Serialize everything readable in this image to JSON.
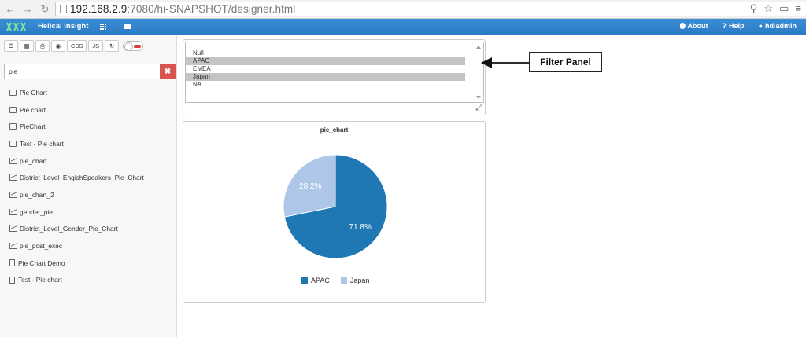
{
  "browser": {
    "url_host": "192.168.2.9",
    "url_path": ":7080/hi-SNAPSHOT/designer.html"
  },
  "app_nav": {
    "brand": "Helical Insight",
    "about": "About",
    "help": "Help",
    "user": "hdiadmin"
  },
  "toolbar": {
    "css_label": "CSS",
    "js_label": "JS"
  },
  "search": {
    "value": "pie",
    "clear_icon": "✖"
  },
  "file_list": [
    {
      "label": "Pie Chart",
      "icon": "folder-icon"
    },
    {
      "label": "Pie chart",
      "icon": "folder-icon"
    },
    {
      "label": "PieChart",
      "icon": "folder-icon"
    },
    {
      "label": "Test - Pie chart",
      "icon": "folder-icon"
    },
    {
      "label": "pie_chart",
      "icon": "line-chart-icon"
    },
    {
      "label": "District_Level_EngishSpeakers_Pie_Chart",
      "icon": "line-chart-icon"
    },
    {
      "label": "pie_chart_2",
      "icon": "line-chart-icon"
    },
    {
      "label": "gender_pie",
      "icon": "line-chart-icon"
    },
    {
      "label": "District_Level_Gender_Pie_Chart",
      "icon": "line-chart-icon"
    },
    {
      "label": "pie_post_exec",
      "icon": "line-chart-icon"
    },
    {
      "label": "Pie Chart Demo",
      "icon": "document-icon"
    },
    {
      "label": "Test - Pie chart",
      "icon": "document-icon"
    }
  ],
  "filter": {
    "options": [
      {
        "label": "Null",
        "selected": false
      },
      {
        "label": "APAC",
        "selected": true
      },
      {
        "label": "EMEA",
        "selected": false
      },
      {
        "label": "Japan",
        "selected": true
      },
      {
        "label": "NA",
        "selected": false
      }
    ]
  },
  "callout": {
    "label": "Filter Panel"
  },
  "chart_data": {
    "type": "pie",
    "title": "pie_chart",
    "categories": [
      "APAC",
      "Japan"
    ],
    "values": [
      71.8,
      28.2
    ],
    "labels": [
      "71.8%",
      "28.2%"
    ],
    "colors": [
      "#1f77b4",
      "#aec7e8"
    ],
    "legend_position": "bottom"
  }
}
